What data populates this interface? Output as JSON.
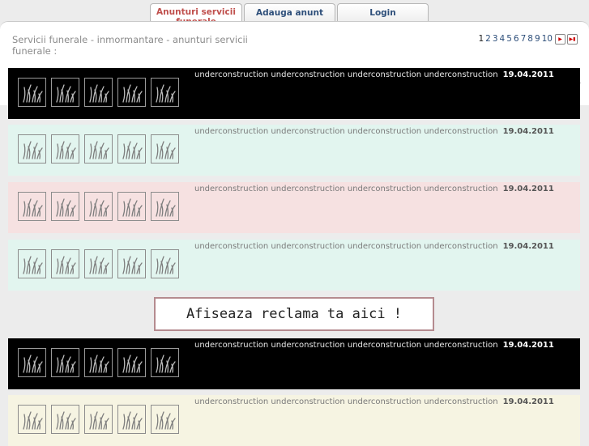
{
  "tabs": [
    {
      "label": "Anunturi servicii funerale",
      "active": true
    },
    {
      "label": "Adauga anunt",
      "active": false
    },
    {
      "label": "Login",
      "active": false
    }
  ],
  "heading": "Servicii funerale - inmormantare - anunturi servicii funerale :",
  "pagination": {
    "pages": [
      "1",
      "2",
      "3",
      "4",
      "5",
      "6",
      "7",
      "8",
      "9",
      "10"
    ],
    "current": "1",
    "next_icon": "next-page-icon",
    "last_icon": "last-page-icon"
  },
  "listings": [
    {
      "description": "underconstruction underconstruction underconstruction underconstruction",
      "date": "19.04.2011",
      "background": "#000000"
    },
    {
      "description": "underconstruction underconstruction underconstruction underconstruction",
      "date": "19.04.2011",
      "background": "#e2f5ef"
    },
    {
      "description": "underconstruction underconstruction underconstruction underconstruction",
      "date": "19.04.2011",
      "background": "#f6e1e1"
    },
    {
      "description": "underconstruction underconstruction underconstruction underconstruction",
      "date": "19.04.2011",
      "background": "#e2f5ef"
    },
    {
      "description": "underconstruction underconstruction underconstruction underconstruction",
      "date": "19.04.2011",
      "background": "#000000"
    },
    {
      "description": "underconstruction underconstruction underconstruction underconstruction",
      "date": "19.04.2011",
      "background": "#f6f4e2"
    }
  ],
  "thumbnail_icon": "grass-icon",
  "ad_banner": "Afiseaza reclama ta aici !"
}
